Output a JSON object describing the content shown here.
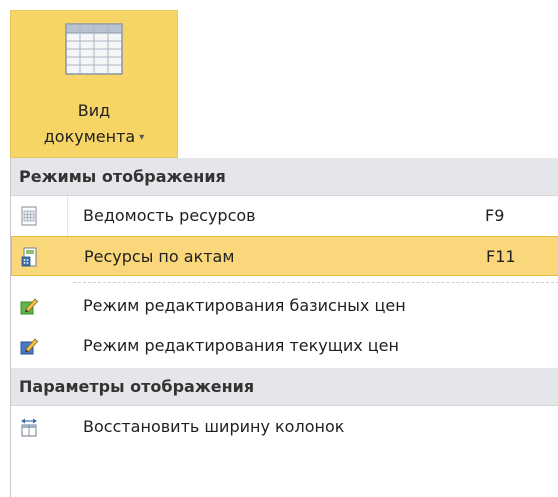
{
  "ribbon": {
    "view_button": {
      "line1": "Вид",
      "line2": "документа",
      "caret": "▾",
      "icon": "table-view-icon"
    }
  },
  "menu": {
    "groups": [
      {
        "header": "Режимы отображения",
        "items": [
          {
            "label": "Ведомость ресурсов",
            "shortcut": "F9",
            "icon": "sheet-icon"
          },
          {
            "label": "Ресурсы по актам",
            "shortcut": "F11",
            "icon": "calculator-doc-icon",
            "active": true
          },
          {
            "label": "Режим редактирования базисных цен",
            "icon": "edit-green-icon"
          },
          {
            "label": "Режим редактирования текущих цен",
            "icon": "edit-blue-icon"
          }
        ]
      },
      {
        "header": "Параметры отображения",
        "items": [
          {
            "label": "Восстановить ширину колонок",
            "icon": "restore-columns-icon"
          }
        ]
      }
    ]
  },
  "colors": {
    "highlight": "#f9d77a",
    "highlight_border": "#e5b94a",
    "ribbon_active": "#f7d466",
    "header_bg": "#e4e6ea"
  }
}
